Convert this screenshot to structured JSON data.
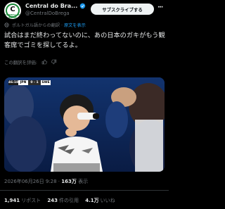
{
  "author": {
    "name": "Central do Bra...",
    "handle": "@CentralDoBrega",
    "avatar_text": "C",
    "avatar_subtext": "CENTRAL DO BREGA"
  },
  "subscribe_label": "サブスクライブする",
  "translation": {
    "note": "ポルトガル語からの翻訳",
    "show_original": "原文を表示"
  },
  "post_text": "試合はまだ終わってないのに、あの日本のガキがもう観客席でゴミを探してるよ。",
  "rate_translation": "この翻訳を評価:",
  "scoreboard": {
    "clock": "46:18",
    "team1": "JPN",
    "score": "0 - 1",
    "team2": "SWE"
  },
  "meta": {
    "date": "2026年06月26日 9:28",
    "views_count": "163万",
    "views_label": "表示"
  },
  "stats": {
    "reposts_count": "1,941",
    "reposts_label": "リポスト",
    "quotes_count": "243",
    "quotes_label": "件の引用",
    "likes_count": "4.1万",
    "likes_label": "いいね"
  },
  "colors": {
    "background": "#000000",
    "accent": "#1d9bf0",
    "muted": "#71767b",
    "verified": "#1d9bf0"
  }
}
